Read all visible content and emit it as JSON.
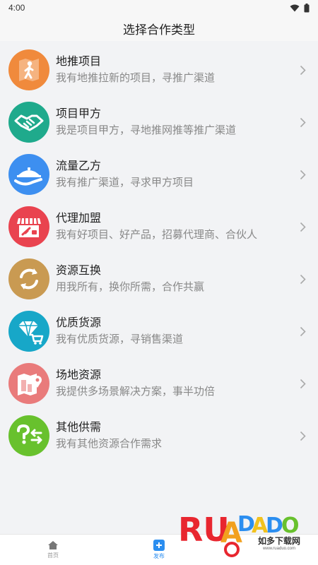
{
  "status_bar": {
    "time": "4:00"
  },
  "header": {
    "title": "选择合作类型"
  },
  "items": [
    {
      "title": "地推项目",
      "desc": "我有地推拉新的项目，寻推广渠道",
      "color": "#f08a3c",
      "icon": "walking-person-map-icon"
    },
    {
      "title": "项目甲方",
      "desc": "我是项目甲方，寻地推网推等推广渠道",
      "color": "#1faa8c",
      "icon": "handshake-icon"
    },
    {
      "title": "流量乙方",
      "desc": "我有推广渠道，寻求甲方项目",
      "color": "#3d8ff0",
      "icon": "hand-offering-icon"
    },
    {
      "title": "代理加盟",
      "desc": "我有好项目、好产品，招募代理商、合伙人",
      "color": "#e9434f",
      "icon": "storefront-icon"
    },
    {
      "title": "资源互换",
      "desc": "用我所有，换你所需，合作共赢",
      "color": "#c99a52",
      "icon": "exchange-arrows-icon"
    },
    {
      "title": "优质货源",
      "desc": "我有优质货源，寻销售渠道",
      "color": "#17a7c8",
      "icon": "diamond-cart-icon"
    },
    {
      "title": "场地资源",
      "desc": "我提供多场景解决方案，事半功倍",
      "color": "#e97b7b",
      "icon": "venue-map-icon"
    },
    {
      "title": "其他供需",
      "desc": "我有其他资源合作需求",
      "color": "#68c12d",
      "icon": "question-exchange-icon"
    }
  ],
  "tabbar": {
    "tabs": [
      {
        "label": "首页",
        "icon": "home-icon"
      },
      {
        "label": "发布",
        "icon": "plus-icon"
      }
    ]
  },
  "watermark": {
    "brand": "RUANDADO",
    "cn": "如多下载网",
    "url": "www.ruaduo.com"
  }
}
